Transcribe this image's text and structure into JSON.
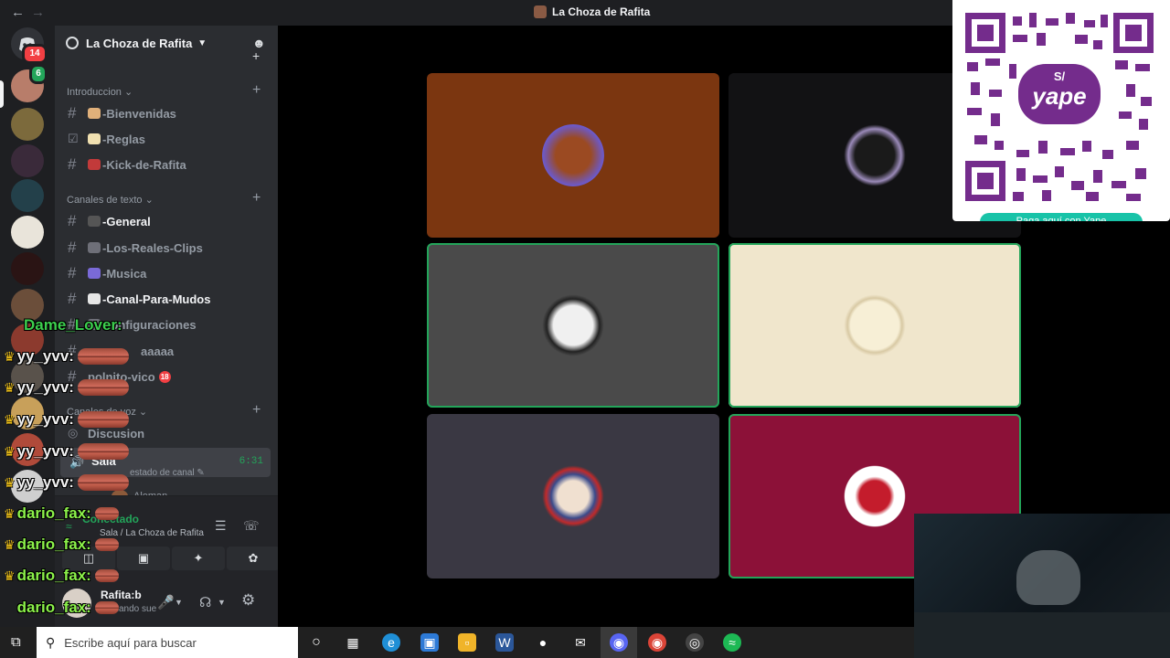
{
  "window": {
    "title": "La Choza de Rafita",
    "back_icon": "arrow-left-icon",
    "forward_icon": "arrow-right-icon"
  },
  "rail": {
    "home_badge": "14",
    "dm_badge": "6"
  },
  "sidebar": {
    "server_name": "La Choza de Rafita",
    "categories": [
      {
        "name": "Introduccion",
        "channels": [
          "-Bienvenidas",
          "-Reglas",
          "-Kick-de-Rafita"
        ]
      },
      {
        "name": "Canales de texto",
        "channels": [
          "-General",
          "-Los-Reales-Clips",
          "-Musica",
          "-Canal-Para-Mudos",
          "Configuraciones",
          "aaaaa",
          "polnito-vico"
        ]
      },
      {
        "name": "Canales de voz",
        "channels": [
          "Discusion"
        ]
      }
    ],
    "nsfw_badge": "18",
    "voice_channel": {
      "name": "Sala",
      "timer": "6:31",
      "status_hint": "estado de canal",
      "member": "Aleman"
    }
  },
  "voice_panel": {
    "status": "Conectado",
    "location": "Sala / La Choza de Rafita"
  },
  "user_panel": {
    "username": "Rafita:b",
    "status": "Firmando sue"
  },
  "qr": {
    "label": "S/",
    "brand": "yape",
    "caption": "Paga aquí con Yape"
  },
  "chat": {
    "lines": [
      {
        "user": "Dame_Lover:",
        "color": "#3ccf4e"
      },
      {
        "user": "yy_yvv:",
        "color": "#f2f2f2"
      },
      {
        "user": "yy_yvv:",
        "color": "#f2f2f2"
      },
      {
        "user": "yy_yvv:",
        "color": "#f2f2f2"
      },
      {
        "user": "yy_yvv:",
        "color": "#f2f2f2"
      },
      {
        "user": "yy_yvv:",
        "color": "#f2f2f2"
      },
      {
        "user": "dario_fax:",
        "color": "#8cf24a"
      },
      {
        "user": "dario_fax:",
        "color": "#8cf24a"
      },
      {
        "user": "dario_fax:",
        "color": "#8cf24a"
      },
      {
        "user": "dario_fax:",
        "color": "#8cf24a"
      }
    ]
  },
  "taskbar": {
    "search_placeholder": "Escribe aquí para buscar"
  },
  "colors": {
    "speaking": "#23a55a",
    "tile_brown": "#7b3610",
    "tile_gray": "#4a4a4a",
    "tile_cream": "#f0e6cc",
    "tile_slate": "#3a3843",
    "tile_crimson": "#8c1138"
  }
}
